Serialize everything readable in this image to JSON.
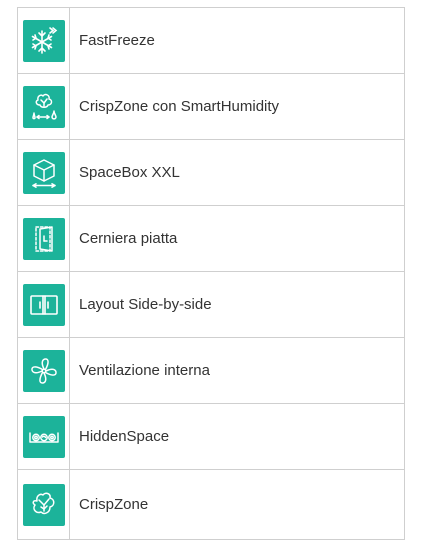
{
  "features": [
    {
      "label": "FastFreeze",
      "icon": "snowflake-icon"
    },
    {
      "label": "CrispZone con SmartHumidity",
      "icon": "vegetable-humidity-icon"
    },
    {
      "label": "SpaceBox XXL",
      "icon": "box-icon"
    },
    {
      "label": "Cerniera piatta",
      "icon": "flat-hinge-door-icon"
    },
    {
      "label": "Layout Side-by-side",
      "icon": "side-by-side-icon"
    },
    {
      "label": "Ventilazione interna",
      "icon": "fan-icon"
    },
    {
      "label": "HiddenSpace",
      "icon": "hidden-space-icon"
    },
    {
      "label": "CrispZone",
      "icon": "vegetable-icon"
    }
  ],
  "colors": {
    "icon_tile": "#1cb39a",
    "border": "#cfcfcf",
    "text": "#333333"
  }
}
